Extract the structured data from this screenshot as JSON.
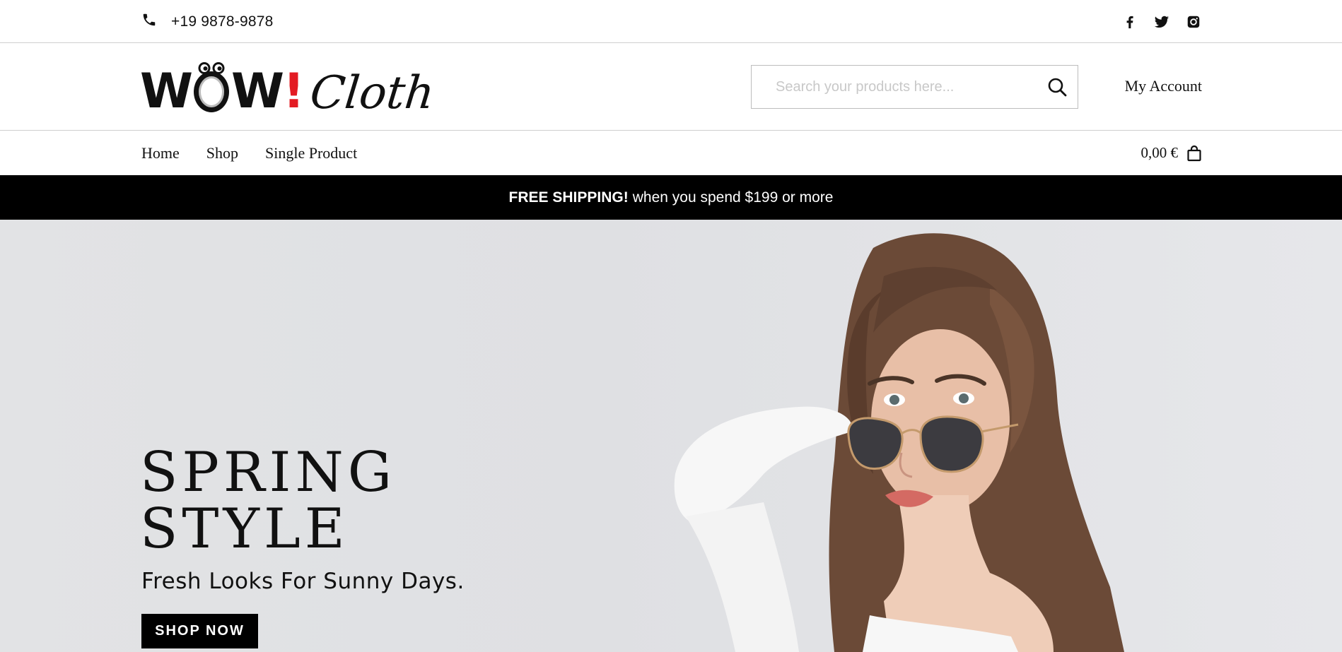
{
  "topbar": {
    "phone": "+19 9878-9878",
    "icons": [
      "phone-icon",
      "facebook-icon",
      "twitter-icon",
      "instagram-icon"
    ]
  },
  "header": {
    "logo": {
      "part1": "W",
      "part2": "W",
      "bang": "!",
      "part3": "Cloth"
    },
    "search_placeholder": "Search your products here...",
    "account_label": "My Account"
  },
  "nav": {
    "items": [
      {
        "label": "Home"
      },
      {
        "label": "Shop"
      },
      {
        "label": "Single Product"
      }
    ],
    "cart_total": "0,00 €"
  },
  "promo": {
    "strong": "FREE SHIPPING!",
    "rest": "when you spend $199 or more"
  },
  "hero": {
    "title_line1": "SPRING",
    "title_line2": "STYLE",
    "subtitle": "Fresh Looks For Sunny Days.",
    "button": "SHOP NOW"
  },
  "colors": {
    "accent": "#e31b23",
    "promo_bg": "#000000",
    "hero_bg": "#e1e2e4"
  }
}
